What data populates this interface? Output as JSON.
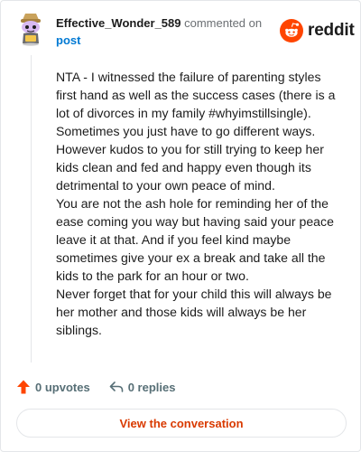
{
  "comment": {
    "username": "Effective_Wonder_589",
    "action_text": " commented on",
    "post_link": "post",
    "body": "NTA - I witnessed the failure of parenting styles first hand as well as the success cases (there is a lot of divorces in my family #whyimstillsingle). Sometimes you just have to go different ways. However kudos to you for still trying to keep her kids clean and fed and happy even though its detrimental to your own peace of mind.\nYou are not the ash hole for reminding her of the ease coming you way but having said your peace leave it at that. And if you feel kind maybe sometimes give your ex a break and take all the kids to the park for an hour or two.\nNever forget that for your child this will always be her mother and those kids will always be her siblings."
  },
  "brand": {
    "name": "reddit",
    "icon": "reddit-logo-icon",
    "color": "#ff4500"
  },
  "actions": {
    "upvotes_label": "0 upvotes",
    "replies_label": "0 replies",
    "upvote_icon": "upvote-arrow-icon",
    "reply_icon": "reply-arrow-icon"
  },
  "cta": {
    "label": "View the conversation",
    "color": "#d93a00"
  },
  "avatar": {
    "icon": "snoo-avatar-icon"
  }
}
